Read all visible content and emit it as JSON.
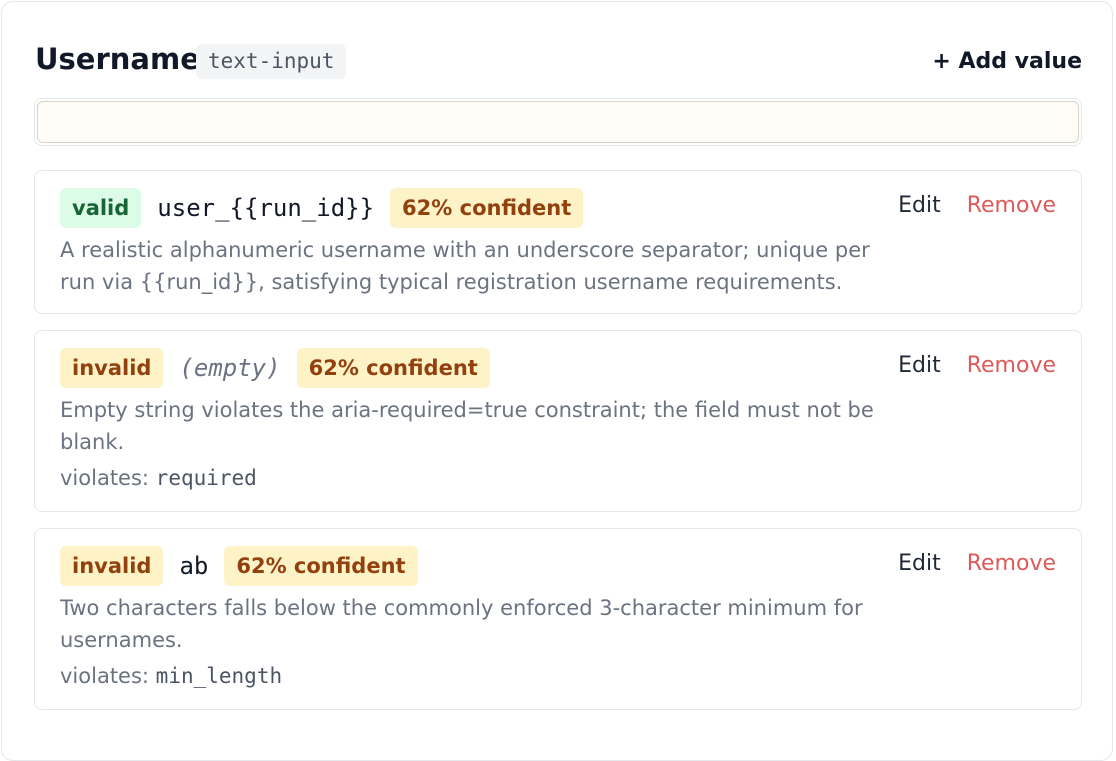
{
  "field": {
    "title": "Username",
    "type_tag": "text-input",
    "add_value_label": "+ Add value",
    "input_value": ""
  },
  "values": [
    {
      "validity": "valid",
      "value": "user_{{run_id}}",
      "confidence": "62% confident",
      "description": "A realistic alphanumeric username with an underscore separator; unique per run via {{run_id}}, satisfying typical registration username requirements.",
      "edit_label": "Edit",
      "remove_label": "Remove"
    },
    {
      "validity": "invalid",
      "value": "(empty)",
      "confidence": "62% confident",
      "description": "Empty string violates the aria-required=true constraint; the field must not be blank.",
      "violates_label": "violates:",
      "violates": "required",
      "edit_label": "Edit",
      "remove_label": "Remove"
    },
    {
      "validity": "invalid",
      "value": "ab",
      "confidence": "62% confident",
      "description": "Two characters falls below the commonly enforced 3-character minimum for usernames.",
      "violates_label": "violates:",
      "violates": "min_length",
      "edit_label": "Edit",
      "remove_label": "Remove"
    }
  ],
  "colors": {
    "valid_badge_bg": "#dcfce7",
    "valid_badge_text": "#166534",
    "invalid_badge_bg": "#fef3c7",
    "invalid_badge_text": "#92400e",
    "remove_action": "#dc5a5a",
    "input_bg": "#fffdf5"
  }
}
